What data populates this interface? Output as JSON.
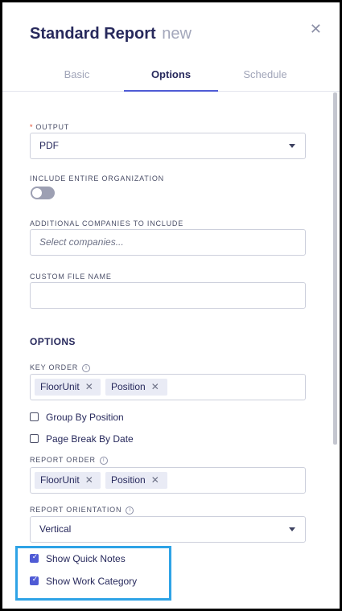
{
  "header": {
    "title": "Standard Report",
    "suffix": "new",
    "close_icon": "close-icon"
  },
  "tabs": [
    {
      "label": "Basic",
      "active": false
    },
    {
      "label": "Options",
      "active": true
    },
    {
      "label": "Schedule",
      "active": false
    }
  ],
  "form": {
    "output": {
      "required_mark": "*",
      "label": "OUTPUT",
      "value": "PDF"
    },
    "include_org": {
      "label": "INCLUDE ENTIRE ORGANIZATION",
      "on": false
    },
    "additional_companies": {
      "label": "ADDITIONAL COMPANIES TO INCLUDE",
      "placeholder": "Select companies..."
    },
    "custom_file_name": {
      "label": "CUSTOM FILE NAME",
      "value": ""
    },
    "options_title": "OPTIONS",
    "key_order": {
      "label": "KEY ORDER",
      "tags": [
        "FloorUnit",
        "Position"
      ]
    },
    "group_by_position": {
      "label": "Group By Position",
      "checked": false
    },
    "page_break_by_date": {
      "label": "Page Break By Date",
      "checked": false
    },
    "report_order": {
      "label": "REPORT ORDER",
      "tags": [
        "FloorUnit",
        "Position"
      ]
    },
    "report_orientation": {
      "label": "REPORT ORIENTATION",
      "value": "Vertical"
    },
    "show_quick_notes": {
      "label": "Show Quick Notes",
      "checked": true
    },
    "show_work_category": {
      "label": "Show Work Category",
      "checked": true
    }
  },
  "glyphs": {
    "tag_remove": "✕",
    "info": "i",
    "check": "✓",
    "close": "✕"
  },
  "colors": {
    "accent": "#4f5bd5",
    "title": "#27295c",
    "required": "#e0482a",
    "highlight": "#2ea3e6"
  }
}
